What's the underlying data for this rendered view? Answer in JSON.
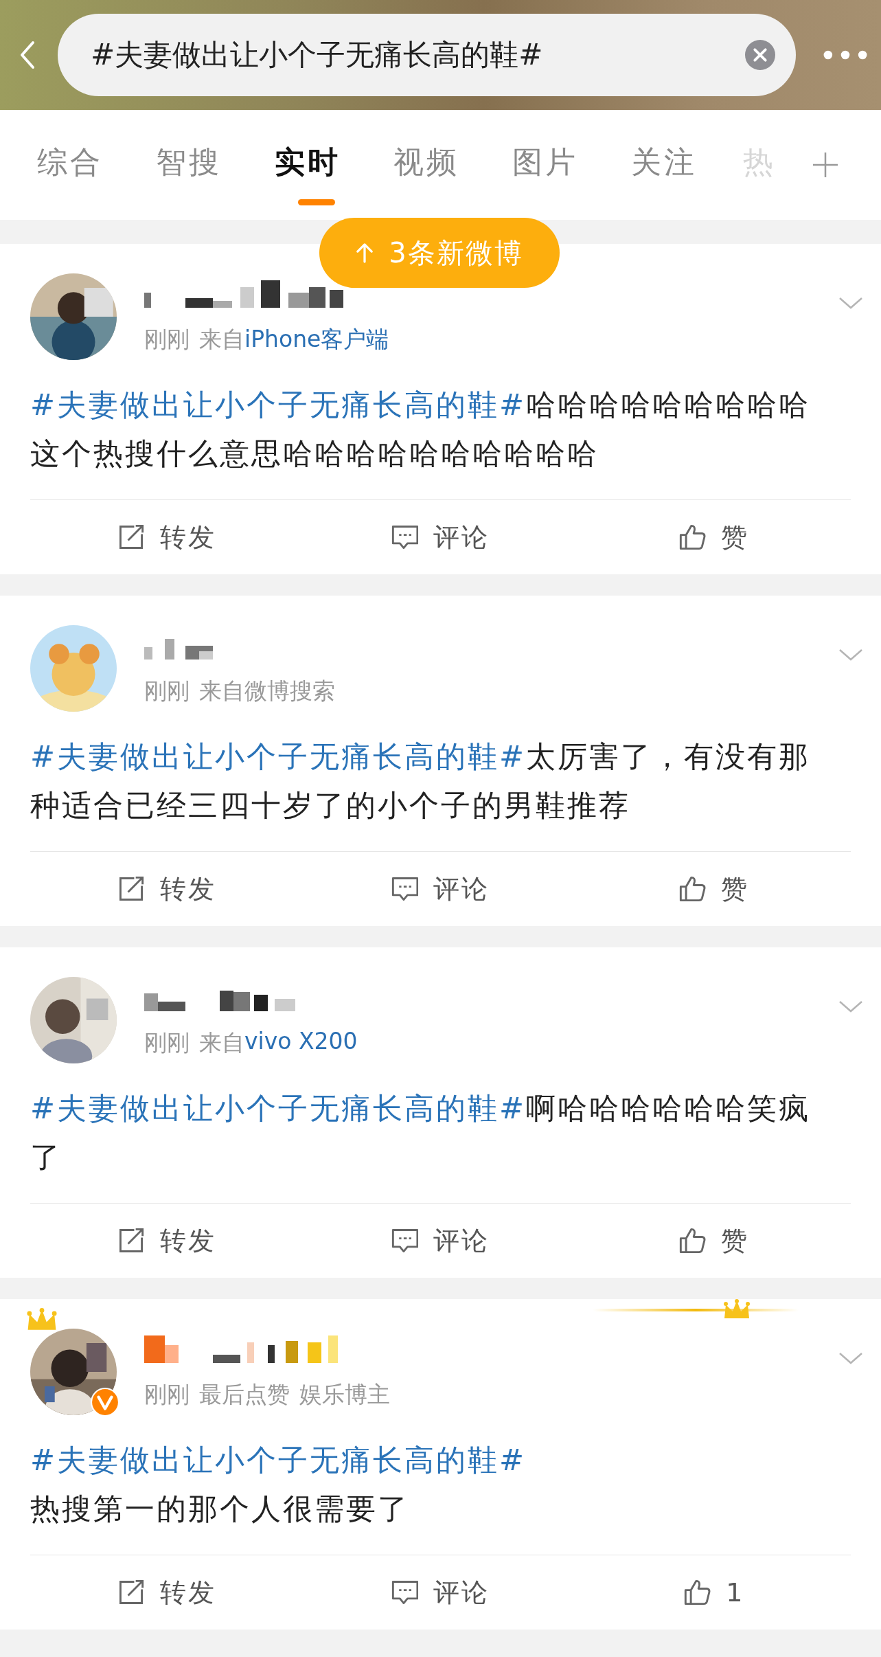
{
  "search": {
    "value": "#夫妻做出让小个子无痛长高的鞋#"
  },
  "tabs": [
    {
      "label": "综合",
      "selected": false
    },
    {
      "label": "智搜",
      "selected": false
    },
    {
      "label": "实时",
      "selected": true
    },
    {
      "label": "视频",
      "selected": false
    },
    {
      "label": "图片",
      "selected": false
    },
    {
      "label": "关注",
      "selected": false
    },
    {
      "label": "热",
      "selected": false
    }
  ],
  "new_posts_button": {
    "label": "3条新微博"
  },
  "posts": [
    {
      "vip": false,
      "verified": false,
      "time": "刚刚",
      "source": {
        "prefix": "来自",
        "name": "iPhone客户端",
        "link": true
      },
      "topic": "#夫妻做出让小个子无痛长高的鞋#",
      "topic_break": false,
      "text": "哈哈哈哈哈哈哈哈哈这个热搜什么意思哈哈哈哈哈哈哈哈哈哈",
      "actions": {
        "repost": "转发",
        "comment": "评论",
        "like": "赞"
      }
    },
    {
      "vip": false,
      "verified": false,
      "time": "刚刚",
      "source": {
        "prefix": "来自",
        "name": "微博搜索",
        "link": false
      },
      "topic": "#夫妻做出让小个子无痛长高的鞋#",
      "topic_break": false,
      "text": "太厉害了，有没有那种适合已经三四十岁了的小个子的男鞋推荐",
      "actions": {
        "repost": "转发",
        "comment": "评论",
        "like": "赞"
      }
    },
    {
      "vip": false,
      "verified": false,
      "time": "刚刚",
      "source": {
        "prefix": "来自",
        "name": "vivo X200",
        "link": true
      },
      "topic": "#夫妻做出让小个子无痛长高的鞋#",
      "topic_break": false,
      "text": "啊哈哈哈哈哈哈笑疯了",
      "actions": {
        "repost": "转发",
        "comment": "评论",
        "like": "赞"
      }
    },
    {
      "vip": true,
      "verified": true,
      "time": "刚刚",
      "tags": [
        "最后点赞",
        "娱乐博主"
      ],
      "topic": "#夫妻做出让小个子无痛长高的鞋#",
      "topic_break": true,
      "text": "热搜第一的那个人很需要了",
      "actions": {
        "repost": "转发",
        "comment": "评论",
        "like": "1"
      }
    }
  ]
}
